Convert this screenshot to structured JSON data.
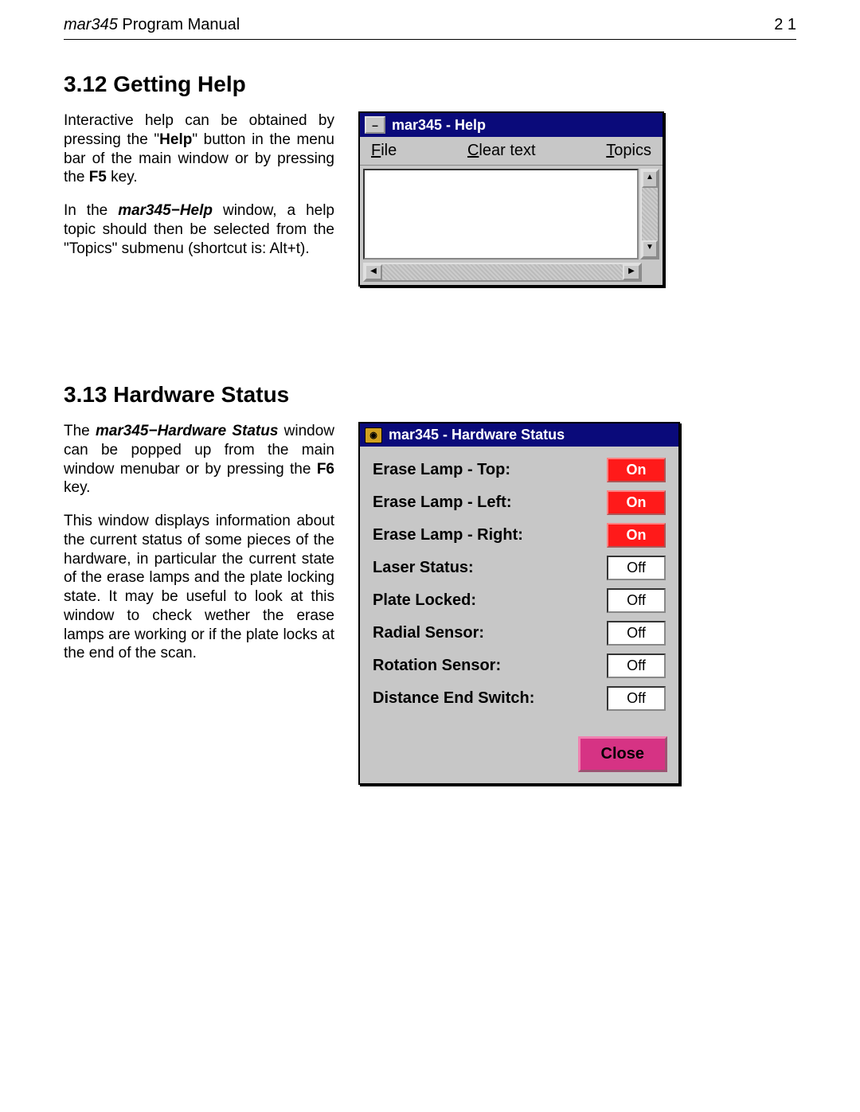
{
  "header": {
    "title_italic": "mar345",
    "title_rest": " Program Manual",
    "page_num": "2 1"
  },
  "section_help": {
    "heading": "3.12 Getting Help",
    "p1_a": "Interactive help can be obtained by pressing the \"",
    "p1_b_bold": "Help",
    "p1_c": "\" button in the menu bar of the main window or by pressing the ",
    "p1_d_bold": "F5",
    "p1_e": " key.",
    "p2_a": "In the ",
    "p2_b_bold": "mar345−Help",
    "p2_c": "  window, a help topic should then be selected from the \"Topics\" submenu (shortcut is: Alt+t)."
  },
  "help_window": {
    "title": "mar345 - Help",
    "menu_file": "File",
    "menu_clear": "Clear text",
    "menu_topics": "Topics"
  },
  "section_hw": {
    "heading": "3.13 Hardware Status",
    "p1_a": "The ",
    "p1_b_bold": "mar345−Hardware Status",
    "p1_c": " window can be popped up from the main window menubar or by pressing the ",
    "p1_d_bold": "F6",
    "p1_e": " key.",
    "p2": "This window displays information about the current status of some pieces of the hardware, in particular the current state of the erase lamps and the plate locking state. It may be useful to look at this window to check wether the erase lamps are working or if the plate locks at the end of the scan."
  },
  "hw_window": {
    "title": "mar345 - Hardware Status",
    "rows": [
      {
        "label": "Erase Lamp - Top:",
        "value": "On",
        "on": true
      },
      {
        "label": "Erase Lamp - Left:",
        "value": "On",
        "on": true
      },
      {
        "label": "Erase Lamp - Right:",
        "value": "On",
        "on": true
      },
      {
        "label": "Laser Status:",
        "value": "Off",
        "on": false
      },
      {
        "label": "Plate Locked:",
        "value": "Off",
        "on": false
      },
      {
        "label": "Radial Sensor:",
        "value": "Off",
        "on": false
      },
      {
        "label": "Rotation Sensor:",
        "value": "Off",
        "on": false
      },
      {
        "label": "Distance End Switch:",
        "value": "Off",
        "on": false
      }
    ],
    "close": "Close"
  }
}
